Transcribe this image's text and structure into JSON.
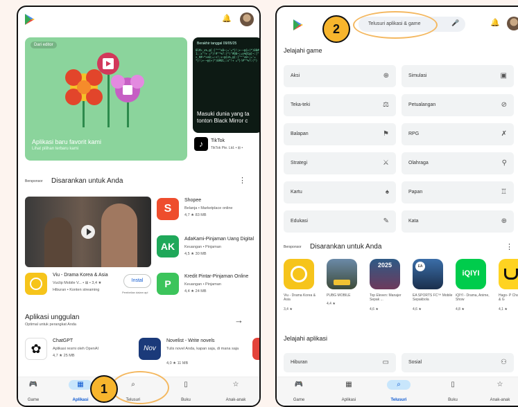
{
  "step_badges": [
    "1",
    "2"
  ],
  "screen1": {
    "featured": {
      "chip": "Dari editor",
      "title": "Aplikasi baru favorit kami",
      "subtitle": "Lihat pilihan terbaru kami",
      "second_chip": "Berakhir tanggal 09/05/25",
      "second_title": "Masuki dunia yang ta tonton Black Mirror c",
      "second_app_name": "TikTok",
      "second_app_dev": "TikTok Pte. Ltd. • ⊞ •"
    },
    "sponsored": {
      "tag": "Bersponsor",
      "title": "Disarankan untuk Anda",
      "side_apps": [
        {
          "name": "Shopee",
          "meta": "Belanja • Marketplace online",
          "stats": "4,7 ★   83 MB"
        },
        {
          "name": "AdaKami-Pinjaman Uang Digital",
          "meta": "Keuangan • Pinjaman",
          "stats": "4,5 ★   30 MB"
        },
        {
          "name": "Kredit Pintar-Pinjaman Online",
          "meta": "Keuangan • Pinjaman",
          "stats": "4,4 ★   24 MB"
        }
      ],
      "video_app": {
        "name": "Viu - Drama Korea & Asia",
        "meta": "Vuclip Mobile V... • ⊞ • 3,4 ★",
        "meta2": "Hiburan • Konten streaming",
        "install": "Instal",
        "note": "Pembelian dalam apl"
      }
    },
    "top_apps": {
      "title": "Aplikasi unggulan",
      "subtitle": "Optimal untuk perangkat Anda",
      "arrow": "→",
      "items": [
        {
          "name": "ChatGPT",
          "meta": "Aplikasi resmi oleh OpenAI",
          "stats": "4,7 ★   25 MB"
        },
        {
          "name": "Novelist - Write novels",
          "meta": "Tulis novel Anda, kapan saja, di mana saja",
          "stats": "4,0 ★   11 MB"
        }
      ]
    },
    "nav": [
      "Game",
      "Aplikasi",
      "Telusuri",
      "Buku",
      "Anak-anak"
    ]
  },
  "screen2": {
    "search_placeholder": "Telusuri aplikasi & game",
    "section_games": "Jelajahi game",
    "categories_left": [
      "Aksi",
      "Teka-teki",
      "Balapan",
      "Strategi",
      "Kartu",
      "Edukasi"
    ],
    "categories_right": [
      "Simulasi",
      "Petualangan",
      "RPG",
      "Olahraga",
      "Papan",
      "Kata"
    ],
    "icons_left": [
      "⊕",
      "⚖",
      "⚑",
      "⚔",
      "♠",
      "✎"
    ],
    "icons_right": [
      "▣",
      "⊘",
      "✗",
      "⚲",
      "♖",
      "⊕"
    ],
    "sponsored_tag": "Bersponsor",
    "sponsored_title": "Disarankan untuk Anda",
    "games": [
      {
        "name": "Viu - Drama Korea & Asia",
        "rating": "3,4 ★"
      },
      {
        "name": "PUBG MOBILE",
        "rating": "4,4 ★"
      },
      {
        "name": "Top Eleven: Manajer Sepak ...",
        "rating": "4,6 ★"
      },
      {
        "name": "EA SPORTS FC™ Mobile Sepakbola",
        "rating": "4,6 ★"
      },
      {
        "name": "iQIYI - Drama, Anime, Show",
        "rating": "4,8 ★"
      },
      {
        "name": "Hago- P Chat & G",
        "rating": "4,1 ★"
      }
    ],
    "section_apps": "Jelajahi aplikasi",
    "app_cats": [
      "Hiburan",
      "Sosial"
    ],
    "nav": [
      "Game",
      "Aplikasi",
      "Telusuri",
      "Buku",
      "Anak-anak"
    ]
  },
  "icons": {
    "bell": "🔔",
    "mic": "🎤",
    "more": "⋮",
    "game": "🎮",
    "apps": "▦",
    "search": "⌕",
    "book": "▯",
    "kids": "☆"
  }
}
